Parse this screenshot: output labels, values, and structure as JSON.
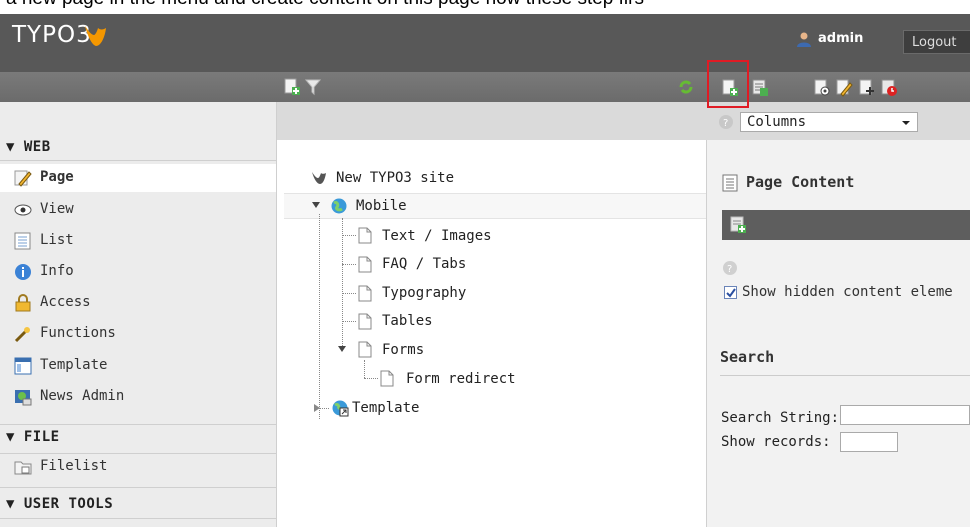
{
  "caption": "a new page in the menu and create content on this page how these step firs",
  "topbar": {
    "logo": "TYPO3",
    "user": "admin",
    "logout": "Logout"
  },
  "menu": {
    "sections": [
      {
        "label": "▼ WEB"
      },
      {
        "label": "▼ FILE"
      },
      {
        "label": "▼ USER TOOLS"
      }
    ],
    "web_items": [
      {
        "label": "Page",
        "icon": "pencil-page-icon",
        "active": true
      },
      {
        "label": "View",
        "icon": "eye-icon"
      },
      {
        "label": "List",
        "icon": "list-icon"
      },
      {
        "label": "Info",
        "icon": "info-icon"
      },
      {
        "label": "Access",
        "icon": "lock-icon"
      },
      {
        "label": "Functions",
        "icon": "wand-icon"
      },
      {
        "label": "Template",
        "icon": "template-icon"
      },
      {
        "label": "News Admin",
        "icon": "news-icon"
      }
    ],
    "file_items": [
      {
        "label": "Filelist",
        "icon": "folder-icon"
      }
    ]
  },
  "tree": {
    "root": "New TYPO3 site",
    "nodes": [
      {
        "label": "Mobile"
      },
      {
        "label": "Text / Images"
      },
      {
        "label": "FAQ / Tabs"
      },
      {
        "label": "Typography"
      },
      {
        "label": "Tables"
      },
      {
        "label": "Forms"
      },
      {
        "label": "Form redirect"
      },
      {
        "label": "Template"
      }
    ]
  },
  "right": {
    "view_select": "Columns",
    "page_content": "Page Content",
    "show_hidden": "Show hidden content eleme",
    "search_heading": "Search",
    "search_string_label": "Search String:",
    "show_records_label": "Show records:"
  },
  "colors": {
    "highlight": "#e01b24",
    "topbar": "#585858"
  }
}
